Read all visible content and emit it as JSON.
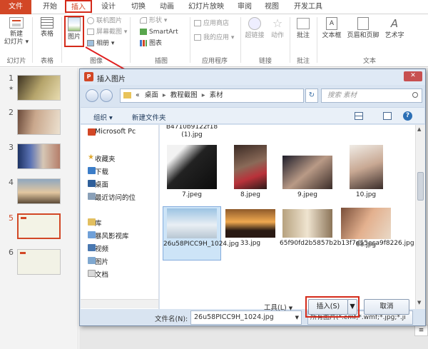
{
  "ribbon_tabs": [
    "文件",
    "开始",
    "插入",
    "设计",
    "切换",
    "动画",
    "幻灯片放映",
    "审阅",
    "视图",
    "开发工具"
  ],
  "ribbon": {
    "new_slide": "新建\n幻灯片",
    "new_slide_l1": "新建",
    "new_slide_l2": "幻灯片 ▾",
    "table": "表格",
    "picture": "图片",
    "online_picture": "联机图片",
    "screenshot": "屏幕截图 ▾",
    "album": "相册 ▾",
    "shapes": "形状 ▾",
    "smartart": "SmartArt",
    "chart": "图表",
    "app_store": "应用商店",
    "my_apps": "我的应用 ▾",
    "hyperlink": "超链接",
    "action": "动作",
    "comment": "批注",
    "textbox": "文本框",
    "header_footer": "页眉和页脚",
    "wordart": "艺术字",
    "groups": {
      "slides": "幻灯片",
      "tables": "表格",
      "images": "图像",
      "illustrations": "插图",
      "apps": "应用程序",
      "links": "链接",
      "comments": "批注",
      "text": "文本"
    }
  },
  "thumbnails": [
    {
      "num": "1",
      "star": "★"
    },
    {
      "num": "2"
    },
    {
      "num": "3"
    },
    {
      "num": "4"
    },
    {
      "num": "5"
    },
    {
      "num": "6"
    }
  ],
  "dialog": {
    "title": "插入图片",
    "path": [
      "«",
      "桌面",
      "▸",
      "教程截图",
      "▸",
      "素材"
    ],
    "search_placeholder": "搜索 素材",
    "organize": "组织 ▾",
    "new_folder": "新建文件夹",
    "nav": [
      "Microsoft Pc",
      "收藏夹",
      "下载",
      "桌面",
      "最近访问的位",
      "库",
      "暴风影视库",
      "视频",
      "图片",
      "文档"
    ],
    "files": [
      {
        "name": "B4710b9122f18 (1).jpg"
      },
      {
        "name": "7.jpeg"
      },
      {
        "name": "8.jpeg"
      },
      {
        "name": "9.jpeg"
      },
      {
        "name": "10.jpg"
      },
      {
        "name": "26u58PICC9H_1024.jpg"
      },
      {
        "name": "33.jpg"
      },
      {
        "name": "65f90fd2b5857b2b13f7d55eca9f8226.jpg"
      },
      {
        "name": "68.jpg"
      }
    ],
    "filename_label": "文件名(N):",
    "filename_value": "26u58PICC9H_1024.jpg",
    "filetype": "所有图片(*.emf;*.wmf;*.jpg;*.ji",
    "tools": "工具(L)",
    "insert": "插入(S)",
    "cancel": "取消"
  },
  "colors": {
    "accent": "#d24726",
    "highlight": "#d42a1a"
  }
}
